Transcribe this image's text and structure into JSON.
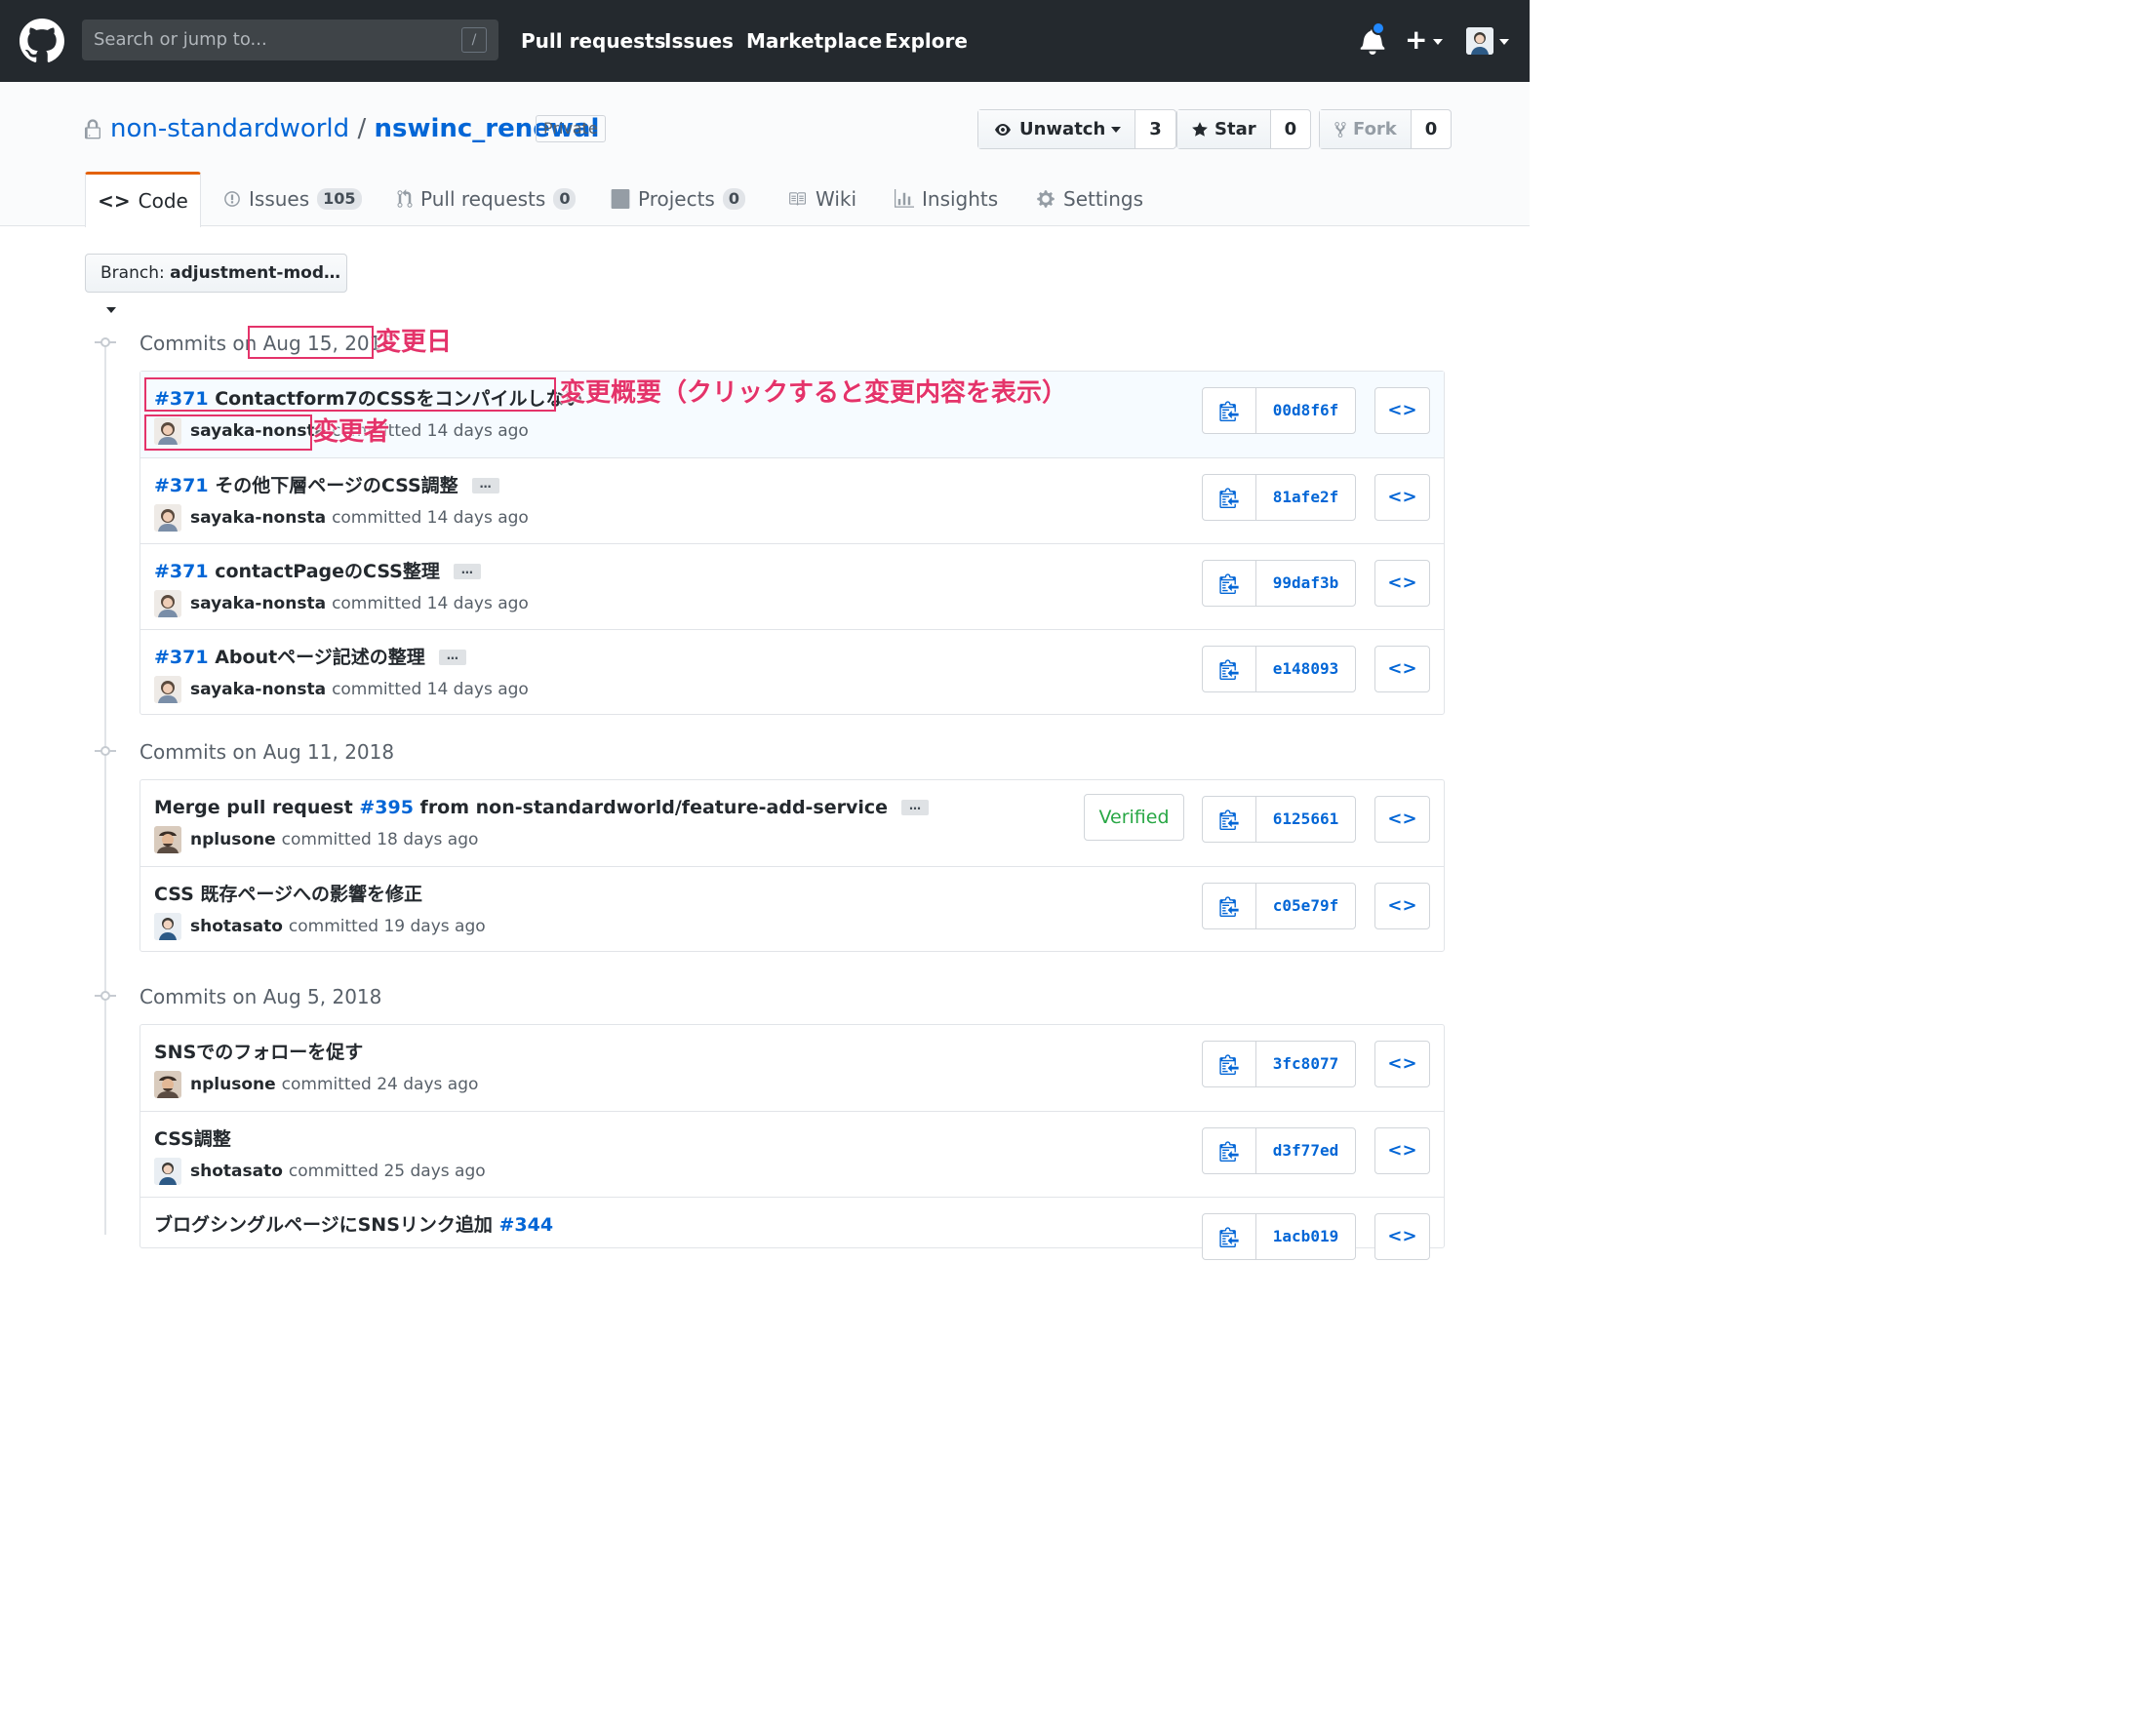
{
  "header": {
    "search_placeholder": "Search or jump to...",
    "slash_hint": "/",
    "nav": [
      "Pull requests",
      "Issues",
      "Marketplace",
      "Explore"
    ],
    "plus": "+"
  },
  "repo": {
    "owner": "non-standardworld",
    "separator": "/",
    "name": "nswinc_renewal",
    "visibility": "Private",
    "watch_label": "Unwatch",
    "watch_count": "3",
    "star_label": "Star",
    "star_count": "0",
    "fork_label": "Fork",
    "fork_count": "0"
  },
  "tabs": [
    {
      "label": "Code"
    },
    {
      "label": "Issues",
      "count": "105"
    },
    {
      "label": "Pull requests",
      "count": "0"
    },
    {
      "label": "Projects",
      "count": "0"
    },
    {
      "label": "Wiki"
    },
    {
      "label": "Insights"
    },
    {
      "label": "Settings"
    }
  ],
  "branch": {
    "prefix": "Branch:",
    "name": "adjustment-mod…"
  },
  "groups": [
    {
      "prefix": "Commits on",
      "date": "Aug 15, 2018",
      "commits": [
        {
          "issue": "#371",
          "message": "Contactform7のCSSをコンパイルしない",
          "author": "sayaka-nonsta",
          "committed": "committed 14 days ago",
          "sha": "00d8f6f"
        },
        {
          "issue": "#371",
          "message": "その他下層ページのCSS調整",
          "author": "sayaka-nonsta",
          "committed": "committed 14 days ago",
          "sha": "81afe2f"
        },
        {
          "issue": "#371",
          "message": "contactPageのCSS整理",
          "author": "sayaka-nonsta",
          "committed": "committed 14 days ago",
          "sha": "99daf3b"
        },
        {
          "issue": "#371",
          "message": "Aboutページ記述の整理",
          "author": "sayaka-nonsta",
          "committed": "committed 14 days ago",
          "sha": "e148093"
        }
      ]
    },
    {
      "prefix": "Commits on",
      "date": "Aug 11, 2018",
      "commits": [
        {
          "pre": "Merge pull request",
          "issue": "#395",
          "message": "from non-standardworld/feature-add-service",
          "author": "nplusone",
          "committed": "committed 18 days ago",
          "sha": "6125661",
          "verified": "Verified"
        },
        {
          "message": "CSS 既存ページへの影響を修正",
          "author": "shotasato",
          "committed": "committed 19 days ago",
          "sha": "c05e79f"
        }
      ]
    },
    {
      "prefix": "Commits on",
      "date": "Aug 5, 2018",
      "commits": [
        {
          "message": "SNSでのフォローを促す",
          "author": "nplusone",
          "committed": "committed 24 days ago",
          "sha": "3fc8077"
        },
        {
          "message": "CSS調整",
          "author": "shotasato",
          "committed": "committed 25 days ago",
          "sha": "d3f77ed"
        },
        {
          "message": "ブログシングルページにSNSリンク追加",
          "issue": "#344",
          "sha": "1acb019"
        }
      ]
    }
  ],
  "ellipsis": "…",
  "browse": "<>",
  "annotations": {
    "date": "変更日",
    "summary": "変更概要（クリックすると変更内容を表示）",
    "author": "変更者"
  },
  "colors": {
    "header_bg": "#24292e",
    "link": "#0366d6",
    "annotation": "#e4336a",
    "verified": "#28a745",
    "tab_accent": "#e36209"
  }
}
